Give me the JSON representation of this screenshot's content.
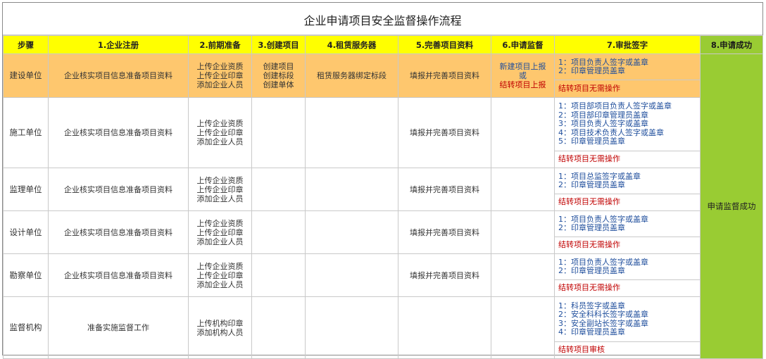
{
  "title": "企业申请项目安全监督操作流程",
  "headers": [
    "步骤",
    "1.企业注册",
    "2.前期准备",
    "3.创建项目",
    "4.租赁服务器",
    "5.完善项目资料",
    "6.申请监督",
    "7.审批签字",
    "8.申请成功"
  ],
  "success_text": "申请监督成功",
  "rows": [
    {
      "unit": "建设单位",
      "reg": "企业核实项目信息准备项目资料",
      "prep": "上传企业资质\n上传企业印章\n添加企业人员",
      "create": "创建项目\n创建标段\n创建单体",
      "server": "租赁服务器绑定标段",
      "complete": "填报并完善项目资料",
      "apply_line1": "新建项目上报",
      "apply_line2": "或",
      "apply_line3": "结转项目上报",
      "approve": "1：项目负责人签字或盖章\n2：印章管理员盖章",
      "approve_note": "结转项目无需操作"
    },
    {
      "unit": "施工单位",
      "reg": "企业核实项目信息准备项目资料",
      "prep": "上传企业资质\n上传企业印章\n添加企业人员",
      "complete": "填报并完善项目资料",
      "approve": "1：项目部项目负责人签字或盖章\n2：项目部印章管理员盖章\n3：项目负责人签字或盖章\n4：项目技术负责人签字或盖章\n5：印章管理员盖章",
      "approve_note": "结转项目无需操作"
    },
    {
      "unit": "监理单位",
      "reg": "企业核实项目信息准备项目资料",
      "prep": "上传企业资质\n上传企业印章\n添加企业人员",
      "complete": "填报并完善项目资料",
      "approve": "1：项目总监签字或盖章\n2：印章管理员盖章",
      "approve_note": "结转项目无需操作"
    },
    {
      "unit": "设计单位",
      "reg": "企业核实项目信息准备项目资料",
      "prep": "上传企业资质\n上传企业印章\n添加企业人员",
      "complete": "填报并完善项目资料",
      "approve": "1：项目负责人签字或盖章\n2：印章管理员盖章",
      "approve_note": "结转项目无需操作"
    },
    {
      "unit": "勘察单位",
      "reg": "企业核实项目信息准备项目资料",
      "prep": "上传企业资质\n上传企业印章\n添加企业人员",
      "complete": "填报并完善项目资料",
      "approve": "1：项目负责人签字或盖章\n2：印章管理员盖章",
      "approve_note": "结转项目无需操作"
    },
    {
      "unit": "监督机构",
      "reg": "准备实施监督工作",
      "prep": "上传机构印章\n添加机构人员",
      "approve": "1：科员签字或盖章\n2：安全科科长签字或盖章\n3：安全副站长签字或盖章\n4：印章管理员盖章",
      "approve_note": "结转项目审核"
    }
  ]
}
